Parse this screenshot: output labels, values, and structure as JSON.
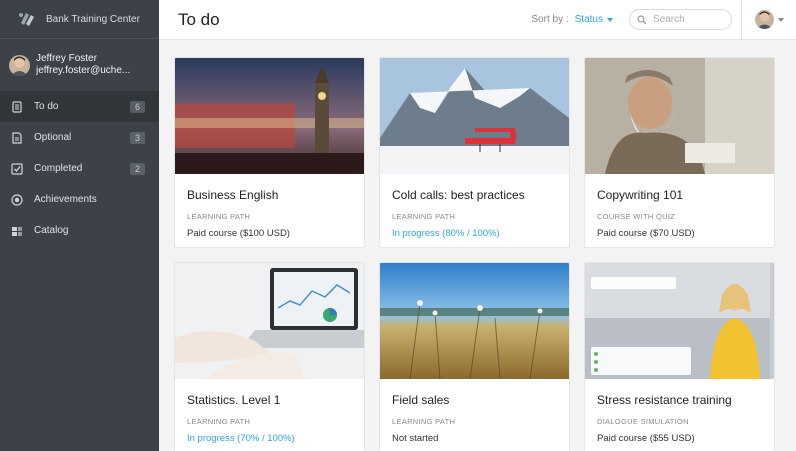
{
  "brand": {
    "name": "Bank Training Center"
  },
  "user": {
    "name": "Jeffrey Foster",
    "email": "jeffrey.foster@uche..."
  },
  "nav": [
    {
      "label": "To do",
      "count": "6",
      "icon": "todo-icon"
    },
    {
      "label": "Optional",
      "count": "3",
      "icon": "optional-icon"
    },
    {
      "label": "Completed",
      "count": "2",
      "icon": "completed-icon"
    },
    {
      "label": "Achievements",
      "icon": "achievements-icon"
    },
    {
      "label": "Catalog",
      "icon": "catalog-icon"
    }
  ],
  "header": {
    "title": "To do",
    "sort_label": "Sort by :",
    "sort_value": "Status",
    "search_placeholder": "Search"
  },
  "colors": {
    "accent": "#2ea3dc",
    "sidebar": "#3c4248",
    "sidebar_active": "#31363b"
  },
  "cards": [
    {
      "title": "Business English",
      "type": "LEARNING PATH",
      "status": "Paid course ($100 USD)",
      "status_kind": "normal"
    },
    {
      "title": "Cold calls: best practices",
      "type": "LEARNING PATH",
      "status": "In progress (80% / 100%)",
      "status_kind": "progress"
    },
    {
      "title": "Copywriting 101",
      "type": "COURSE WITH QUIZ",
      "status": "Paid course ($70 USD)",
      "status_kind": "normal"
    },
    {
      "title": "Statistics. Level 1",
      "type": "LEARNING PATH",
      "status": "In progress (70% / 100%)",
      "status_kind": "progress"
    },
    {
      "title": "Field sales",
      "type": "LEARNING PATH",
      "status": "Not started",
      "status_kind": "normal"
    },
    {
      "title": "Stress resistance training",
      "type": "DIALOGUE SIMULATION",
      "status": "Paid course ($55 USD)",
      "status_kind": "normal"
    }
  ]
}
